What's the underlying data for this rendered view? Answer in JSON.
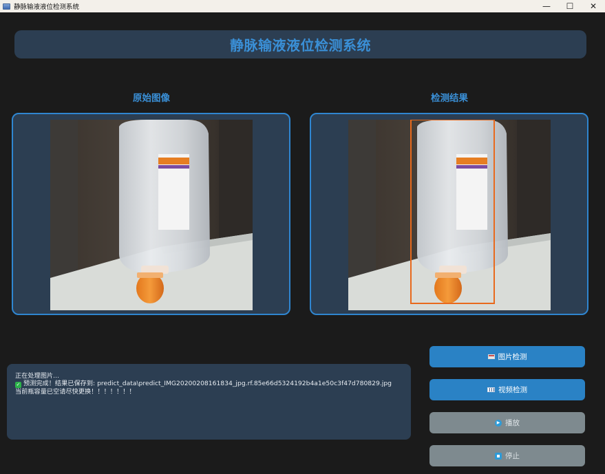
{
  "window": {
    "title": "静脉输液液位检测系统",
    "controls": {
      "minimize": "—",
      "maximize": "☐",
      "close": "✕"
    }
  },
  "header": {
    "title": "静脉输液液位检测系统"
  },
  "panels": {
    "original_label": "原始图像",
    "result_label": "检测结果"
  },
  "log": {
    "lines": [
      "正在处理图片...",
      "预测完成！结果已保存到: predict_data\\predict_IMG20200208161834_jpg.rf.85e66d5324192b4a1e50c3f47d780829.jpg",
      "当前瓶容量已空请尽快更换！！！！！！！"
    ]
  },
  "buttons": {
    "image_detect": "图片检测",
    "video_detect": "视频检测",
    "play": "播放",
    "stop": "停止"
  },
  "icons": {
    "image_detect": "image-icon",
    "video_detect": "film-icon",
    "play": "play-icon",
    "stop": "stop-icon",
    "log_success": "check-icon"
  },
  "colors": {
    "accent": "#3a8fd6",
    "panel_bg": "#2c3e52",
    "window_bg": "#1b1b1b",
    "button_active": "#2a82c5",
    "button_disabled": "#7e8a8f",
    "detection_box": "#e8691c"
  }
}
